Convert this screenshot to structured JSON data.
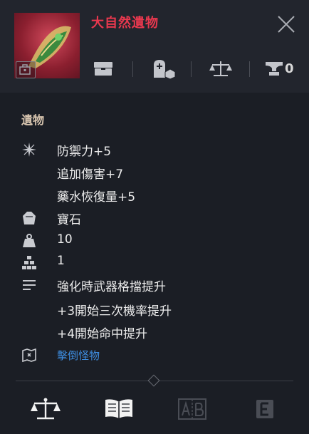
{
  "header": {
    "title": "大自然遺物",
    "relic_count": "0"
  },
  "section": {
    "title": "遺物"
  },
  "stats": {
    "attributes": [
      "防禦力+5",
      "追加傷害+7",
      "藥水恢復量+5"
    ],
    "material": "寶石",
    "weight": "10",
    "level": "1",
    "effects": [
      "強化時武器格擋提升",
      "+3開始三次機率提升",
      "+4開始命中提升"
    ],
    "source_link": "擊倒怪物"
  },
  "colors": {
    "title": "#e8384e",
    "section": "#d9c6b0",
    "link": "#3e8de0",
    "text": "#ededed",
    "icon": "#bfc1c6"
  }
}
